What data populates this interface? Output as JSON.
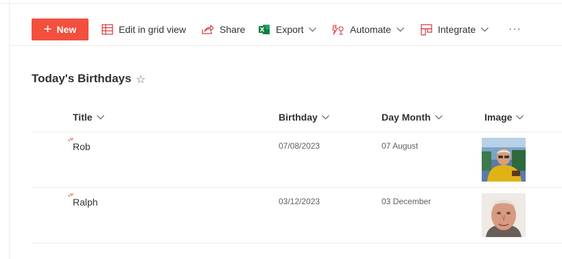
{
  "commandbar": {
    "new_label": "New",
    "grid_label": "Edit in grid view",
    "share_label": "Share",
    "export_label": "Export",
    "automate_label": "Automate",
    "integrate_label": "Integrate",
    "more_label": "···"
  },
  "list": {
    "title": "Today's Birthdays",
    "star_icon": "☆",
    "columns": [
      "Title",
      "Birthday",
      "Day Month",
      "Image"
    ],
    "rows": [
      {
        "title": "Rob",
        "birthday": "07/08/2023",
        "day_month": "07 August",
        "image": "rob-photo"
      },
      {
        "title": "Ralph",
        "birthday": "03/12/2023",
        "day_month": "03 December",
        "image": "ralph-photo"
      }
    ]
  },
  "colors": {
    "accent": "#f24f3e",
    "excel_green": "#107c41",
    "divider": "#edebe9"
  }
}
